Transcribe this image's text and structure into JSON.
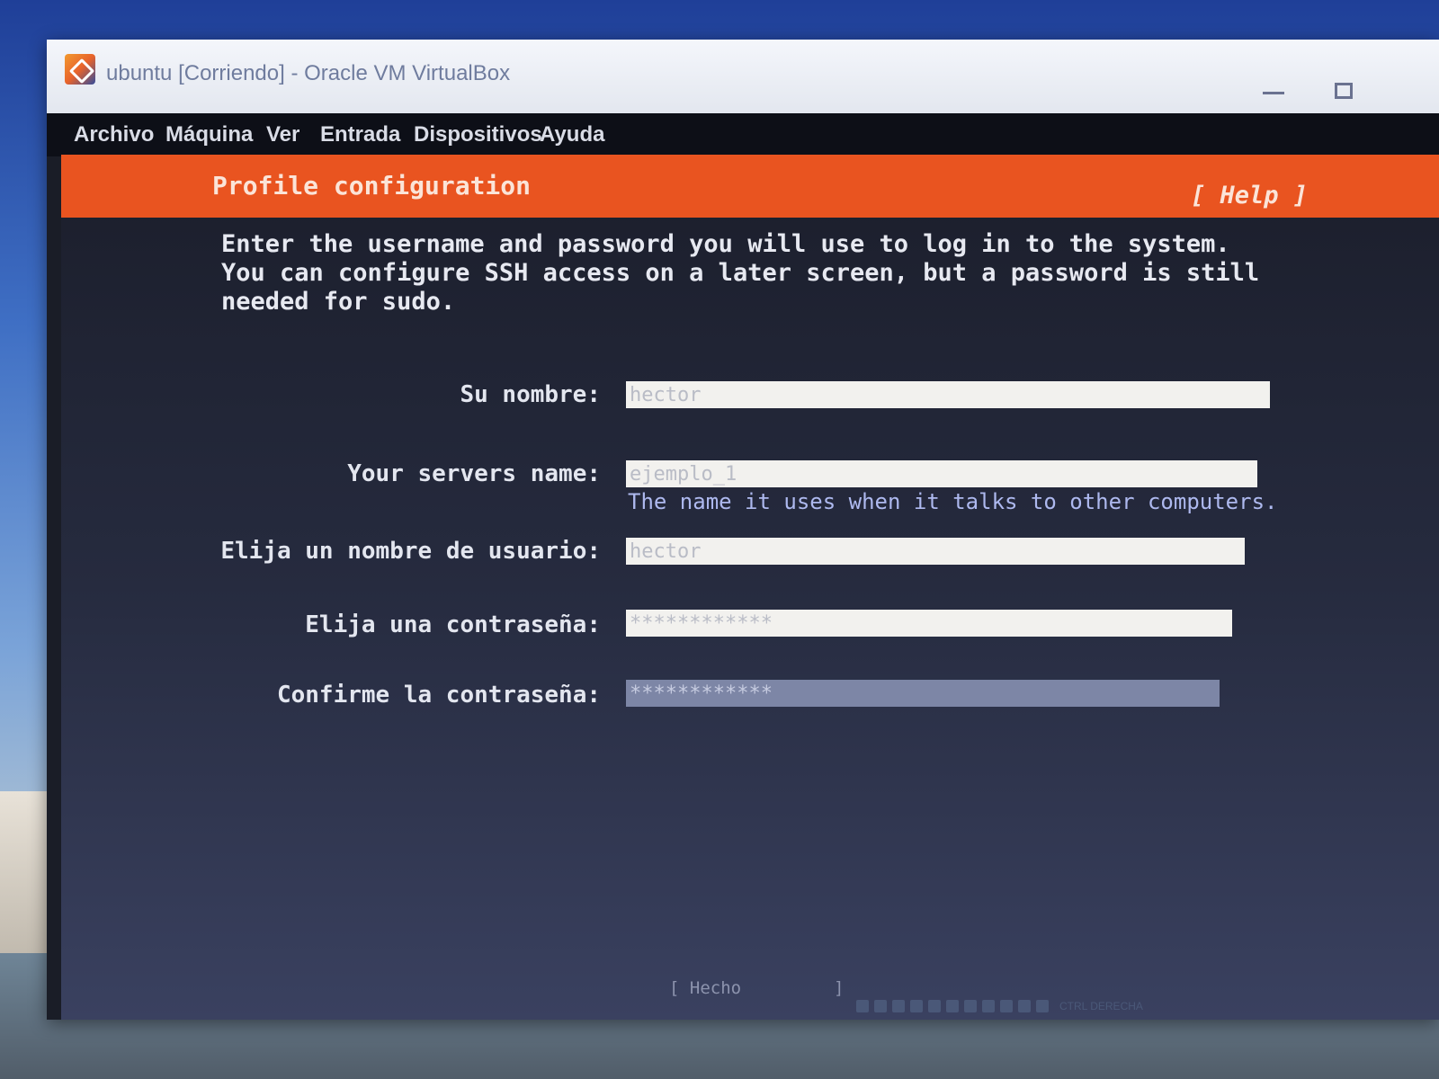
{
  "window": {
    "title": "ubuntu [Corriendo] - Oracle VM VirtualBox"
  },
  "menubar": {
    "items": [
      {
        "label": "Archivo"
      },
      {
        "label": "Máquina"
      },
      {
        "label": "Ver"
      },
      {
        "label": "Entrada"
      },
      {
        "label": "Dispositivos"
      },
      {
        "label": "Ayuda"
      }
    ]
  },
  "installer": {
    "header_title": "Profile configuration",
    "help_label": "[ Help ]",
    "intro_text": "Enter the username and password you will use to log in to the system. You can configure SSH access on a later screen, but a password is still needed for sudo.",
    "fields": {
      "name": {
        "label": "Su nombre:",
        "value": "hector"
      },
      "server": {
        "label": "Your servers name:",
        "value": "ejemplo_1",
        "hint": "The name it uses when it talks to other computers."
      },
      "username": {
        "label": "Elija un nombre de usuario:",
        "value": "hector"
      },
      "password": {
        "label": "Elija una contraseña:",
        "value": "************"
      },
      "confirm": {
        "label": "Confirme la contraseña:",
        "value": "************"
      }
    },
    "done_label": "[ Hecho         ]"
  },
  "statusbar": {
    "host_key": "CTRL DERECHA"
  },
  "colors": {
    "accent": "#e95420",
    "background": "#1b1e2b",
    "focused_field": "#7d86a6"
  }
}
